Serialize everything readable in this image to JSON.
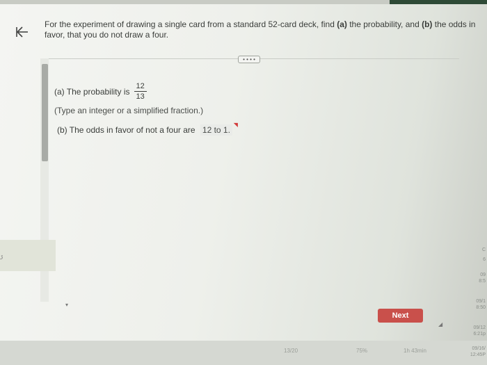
{
  "question": {
    "prefix": "For the experiment of drawing a single card from a standard 52-card deck, find ",
    "part_a_marker": "(a)",
    "middle": " the probability, and ",
    "part_b_marker": "(b)",
    "suffix": " the odds in favor, that you do not draw a four."
  },
  "separator_button": "• • • •",
  "part_a": {
    "label": "(a) The probability is",
    "numerator": "12",
    "denominator": "13",
    "hint": "(Type an integer or a simplified fraction.)"
  },
  "part_b": {
    "label": "(b) The odds in favor of not a four are",
    "answer": "12 to 1."
  },
  "next_button": "Next",
  "status": {
    "page": "13/20",
    "percent": "75%",
    "time": "1h 43min"
  },
  "right_panel": [
    "C",
    "6",
    "09",
    "8:5",
    "09/1",
    "8:50",
    "09/12",
    "6:21p",
    "09/16/",
    "12:45P"
  ],
  "colors": {
    "next_button": "#c9504b",
    "flag": "#d23a3a"
  },
  "icons": {
    "back": "back-arrow-icon",
    "flag": "flag-icon"
  }
}
